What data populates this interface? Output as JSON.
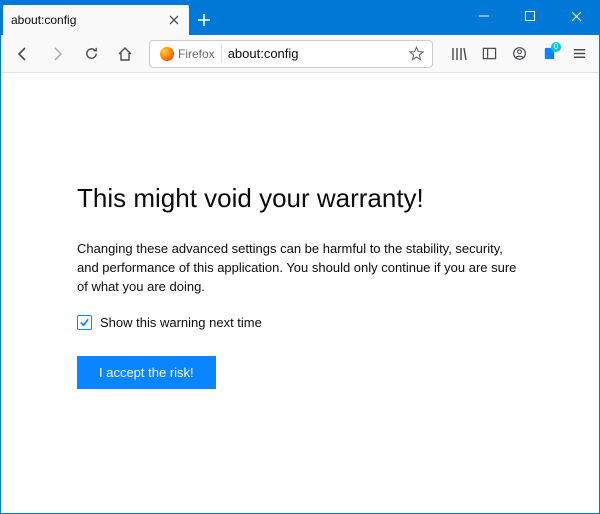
{
  "tab": {
    "title": "about:config"
  },
  "window_controls": {
    "minimize": "minimize",
    "maximize": "maximize",
    "close": "close"
  },
  "nav": {
    "identity_label": "Firefox",
    "url": "about:config"
  },
  "toolbar": {
    "notification_count": "0"
  },
  "warning": {
    "heading": "This might void your warranty!",
    "description": "Changing these advanced settings can be harmful to the stability, security, and performance of this application. You should only continue if you are sure of what you are doing.",
    "checkbox_label": "Show this warning next time",
    "checkbox_checked": true,
    "accept_button": "I accept the risk!"
  }
}
